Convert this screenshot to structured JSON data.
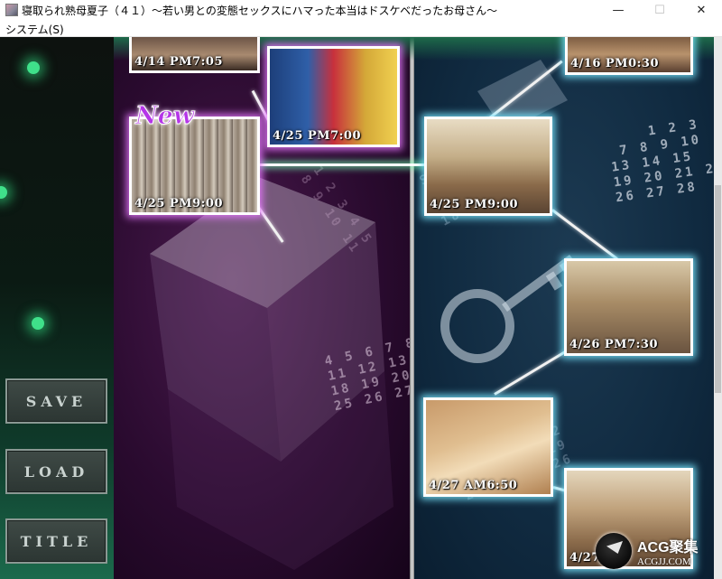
{
  "window": {
    "title": "寝取られ熟母夏子（４１）～若い男との変態セックスにハマった本当はドスケベだったお母さん～",
    "minimize_glyph": "—",
    "maximize_glyph": "☐",
    "close_glyph": "✕"
  },
  "menu": {
    "system_label": "システム(S)"
  },
  "side_buttons": {
    "save": "SAVE",
    "load": "LOAD",
    "title": "TITLE"
  },
  "new_badge": "New",
  "scenes": [
    {
      "time": "4/14 PM7:05",
      "panel": "purple"
    },
    {
      "time": "4/25 PM7:00",
      "panel": "purple"
    },
    {
      "time": "4/25 PM9:00",
      "panel": "purple",
      "is_new": true
    },
    {
      "time": "4/16 PM0:30",
      "panel": "blue"
    },
    {
      "time": "4/25 PM9:00",
      "panel": "blue"
    },
    {
      "time": "4/26 PM7:30",
      "panel": "blue"
    },
    {
      "time": "4/27 AM6:50",
      "panel": "blue"
    },
    {
      "time": "4/27",
      "panel": "blue"
    }
  ],
  "watermark": {
    "main": "ACG聚集",
    "sub": "ACGJJ.COM"
  },
  "colors": {
    "purple_glow": "#e678ff",
    "blue_glow": "#78e6ff",
    "side_accent": "#3fe08a"
  }
}
